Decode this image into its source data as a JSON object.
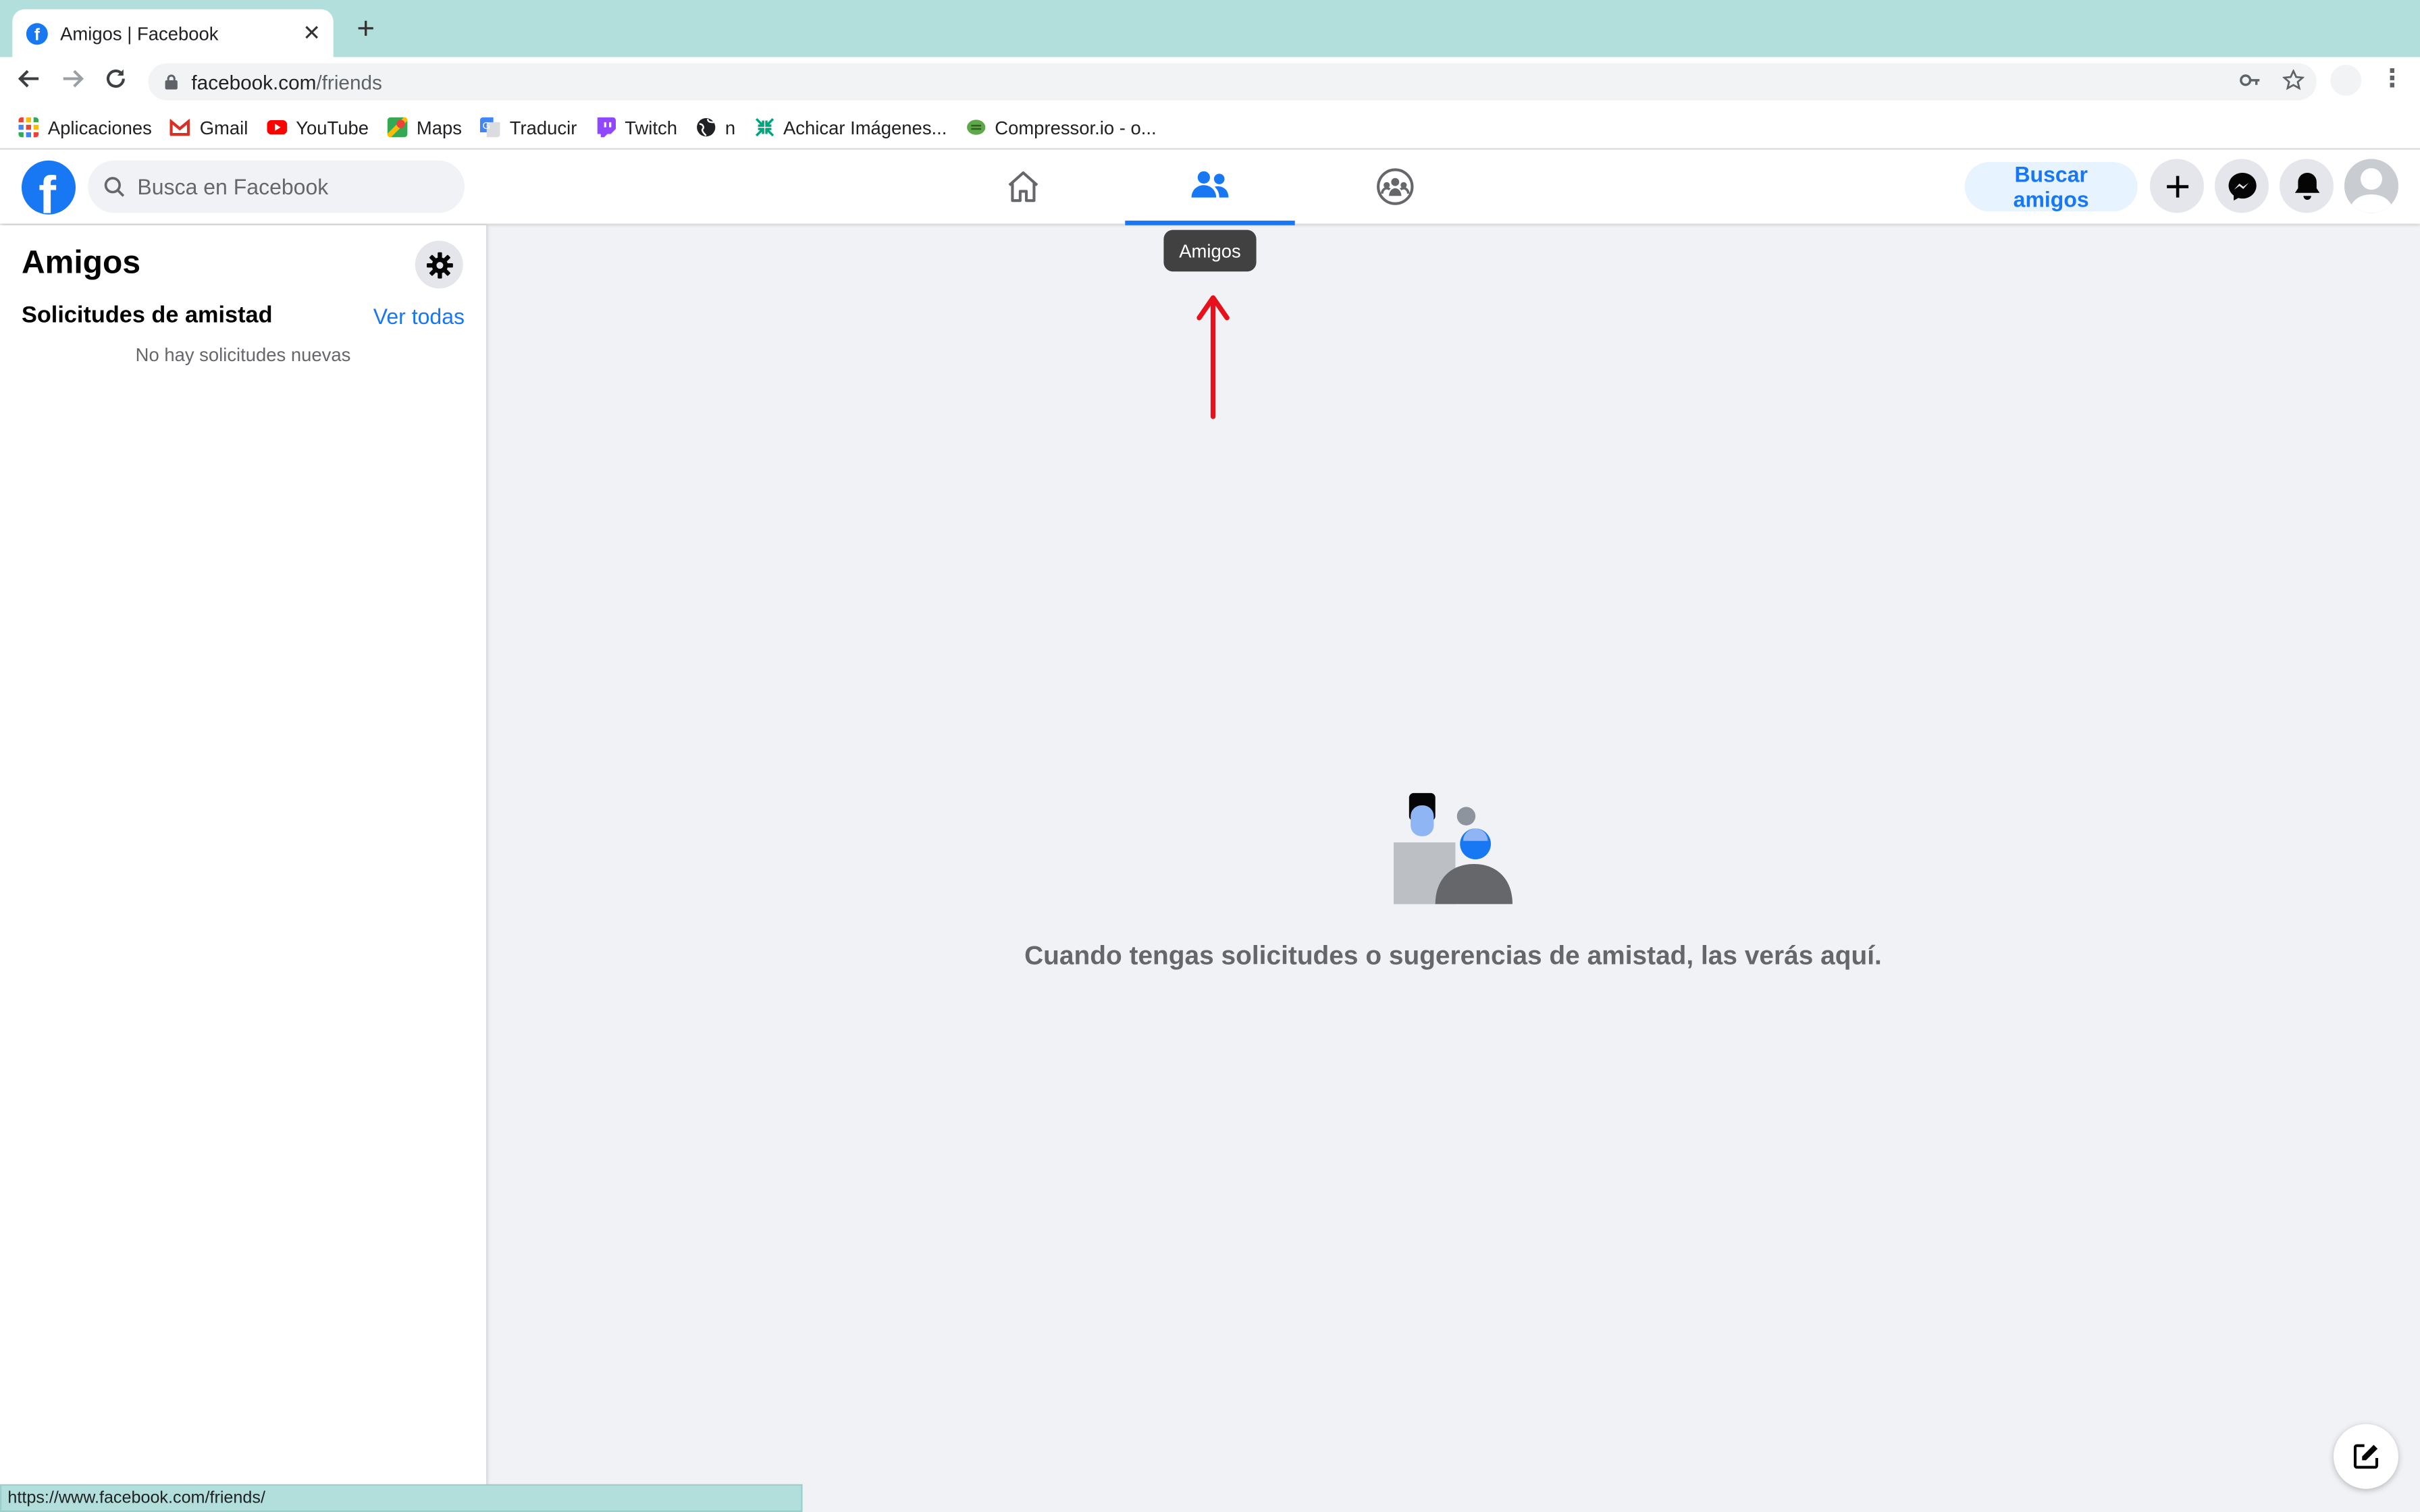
{
  "browser": {
    "tab_title": "Amigos | Facebook",
    "new_tab": "+",
    "url_host": "facebook.com",
    "url_path": "/friends",
    "bookmarks": [
      {
        "label": "Aplicaciones",
        "icon": "apps-grid-icon",
        "color": "#ea4335"
      },
      {
        "label": "Gmail",
        "icon": "gmail-icon",
        "color": "#d93025"
      },
      {
        "label": "YouTube",
        "icon": "youtube-icon",
        "color": "#ff0000"
      },
      {
        "label": "Maps",
        "icon": "maps-icon",
        "color": "#34a853"
      },
      {
        "label": "Traducir",
        "icon": "translate-icon",
        "color": "#4285f4"
      },
      {
        "label": "Twitch",
        "icon": "twitch-icon",
        "color": "#9146ff"
      },
      {
        "label": "n",
        "icon": "globe-icon",
        "color": "#202124"
      },
      {
        "label": "Achicar Imágenes...",
        "icon": "compress-icon",
        "color": "#00a37a"
      },
      {
        "label": "Compressor.io - o...",
        "icon": "compressor-icon",
        "color": "#5fa84a"
      }
    ],
    "status_url": "https://www.facebook.com/friends/"
  },
  "header": {
    "search_placeholder": "Busca en Facebook",
    "find_friends": "Buscar amigos",
    "tooltip": "Amigos",
    "brand_color": "#1877f2"
  },
  "sidebar": {
    "title": "Amigos",
    "requests_heading": "Solicitudes de amistad",
    "see_all": "Ver todas",
    "empty": "No hay solicitudes nuevas"
  },
  "main": {
    "empty_message": "Cuando tengas solicitudes o sugerencias de amistad, las verás aquí."
  }
}
